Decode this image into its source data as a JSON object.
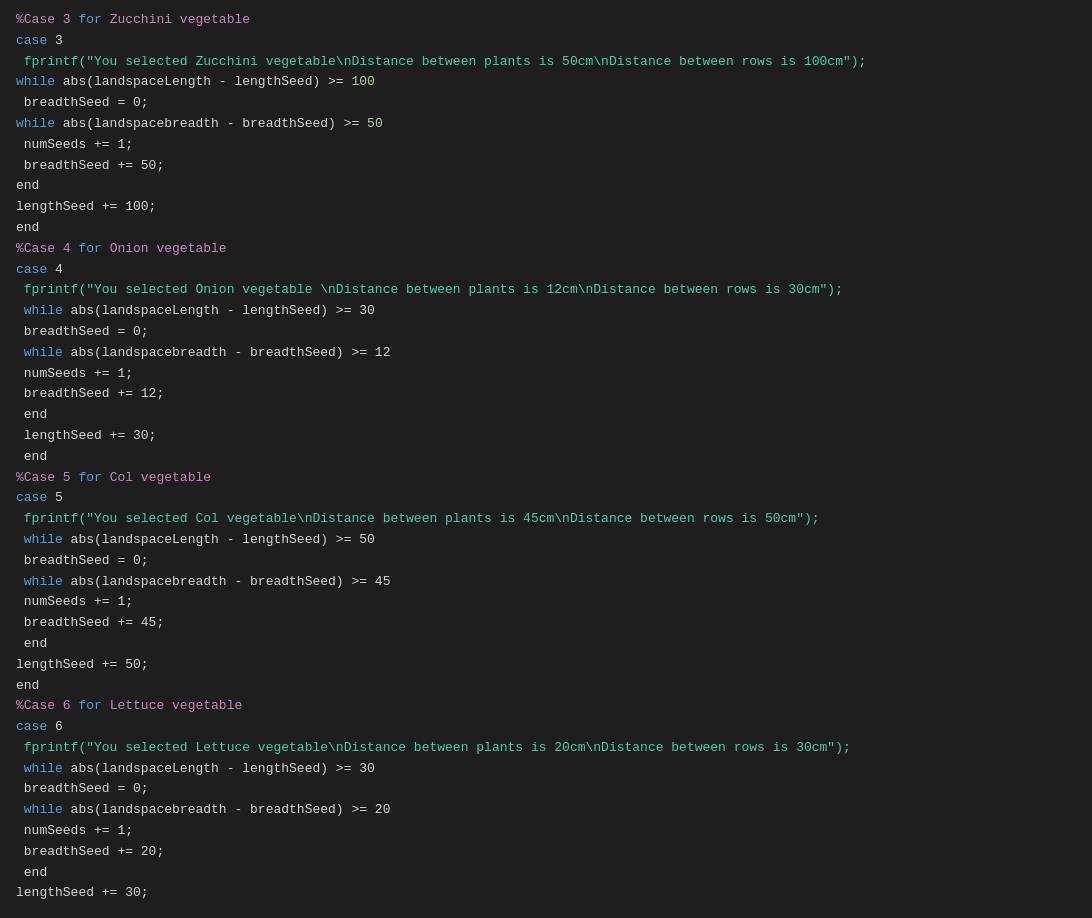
{
  "code": {
    "lines": [
      {
        "id": "l1",
        "parts": [
          {
            "text": "%Case 3 ",
            "cls": "comment"
          },
          {
            "text": "for",
            "cls": "keyword"
          },
          {
            "text": " Zucchini vegetable",
            "cls": "comment"
          }
        ]
      },
      {
        "id": "l2",
        "parts": [
          {
            "text": "case",
            "cls": "keyword"
          },
          {
            "text": " 3",
            "cls": "plain"
          }
        ]
      },
      {
        "id": "l3",
        "parts": [
          {
            "text": " fprintf(\"You selected Zucchini vegetable\\nDistance between plants is 50cm\\nDistance between rows is 100cm\");",
            "cls": "string"
          }
        ]
      },
      {
        "id": "l4",
        "parts": [
          {
            "text": "while",
            "cls": "keyword"
          },
          {
            "text": " abs(landspaceLength - lengthSeed) ",
            "cls": "plain"
          },
          {
            "text": ">=",
            "cls": "plain"
          },
          {
            "text": " 100",
            "cls": "number"
          }
        ]
      },
      {
        "id": "l5",
        "parts": [
          {
            "text": " breadthSeed = 0;",
            "cls": "plain"
          }
        ]
      },
      {
        "id": "l6",
        "parts": [
          {
            "text": "while",
            "cls": "keyword"
          },
          {
            "text": " abs(landspacebreadth - breadthSeed) ",
            "cls": "plain"
          },
          {
            "text": ">=",
            "cls": "plain"
          },
          {
            "text": " 50",
            "cls": "number"
          }
        ]
      },
      {
        "id": "l7",
        "parts": [
          {
            "text": " numSeeds += 1;",
            "cls": "plain"
          }
        ]
      },
      {
        "id": "l8",
        "parts": [
          {
            "text": " breadthSeed += 50;",
            "cls": "plain"
          }
        ]
      },
      {
        "id": "l9",
        "parts": [
          {
            "text": "end",
            "cls": "plain"
          }
        ]
      },
      {
        "id": "l10",
        "parts": [
          {
            "text": "lengthSeed += 100;",
            "cls": "plain"
          }
        ]
      },
      {
        "id": "l11",
        "parts": [
          {
            "text": "end",
            "cls": "plain"
          }
        ]
      },
      {
        "id": "l12",
        "parts": [
          {
            "text": "%Case 4 ",
            "cls": "comment"
          },
          {
            "text": "for",
            "cls": "keyword"
          },
          {
            "text": " Onion vegetable",
            "cls": "comment"
          }
        ]
      },
      {
        "id": "l13",
        "parts": [
          {
            "text": "case",
            "cls": "keyword"
          },
          {
            "text": " 4",
            "cls": "plain"
          }
        ]
      },
      {
        "id": "l14",
        "parts": [
          {
            "text": " fprintf(\"You selected Onion vegetable \\nDistance between plants is 12cm\\nDistance between rows is 30cm\");",
            "cls": "string"
          }
        ]
      },
      {
        "id": "l15",
        "parts": [
          {
            "text": " while",
            "cls": "keyword"
          },
          {
            "text": " abs(landspaceLength - lengthSeed) >= 30",
            "cls": "plain"
          }
        ]
      },
      {
        "id": "l16",
        "parts": [
          {
            "text": " breadthSeed = 0;",
            "cls": "plain"
          }
        ]
      },
      {
        "id": "l17",
        "parts": [
          {
            "text": " while",
            "cls": "keyword"
          },
          {
            "text": " abs(landspacebreadth - breadthSeed) >= 12",
            "cls": "plain"
          }
        ]
      },
      {
        "id": "l18",
        "parts": [
          {
            "text": " numSeeds += 1;",
            "cls": "plain"
          }
        ]
      },
      {
        "id": "l19",
        "parts": [
          {
            "text": " breadthSeed += 12;",
            "cls": "plain"
          }
        ]
      },
      {
        "id": "l20",
        "parts": [
          {
            "text": " end",
            "cls": "plain"
          }
        ]
      },
      {
        "id": "l21",
        "parts": [
          {
            "text": " lengthSeed += 30;",
            "cls": "plain"
          }
        ]
      },
      {
        "id": "l22",
        "parts": [
          {
            "text": " end",
            "cls": "plain"
          }
        ]
      },
      {
        "id": "l23",
        "parts": [
          {
            "text": "%Case 5 ",
            "cls": "comment"
          },
          {
            "text": "for",
            "cls": "keyword"
          },
          {
            "text": " Col vegetable",
            "cls": "comment"
          }
        ]
      },
      {
        "id": "l24",
        "parts": [
          {
            "text": "case",
            "cls": "keyword"
          },
          {
            "text": " 5",
            "cls": "plain"
          }
        ]
      },
      {
        "id": "l25",
        "parts": [
          {
            "text": " fprintf(\"You selected Col vegetable\\nDistance between plants is 45cm\\nDistance between rows is 50cm\");",
            "cls": "string"
          }
        ]
      },
      {
        "id": "l26",
        "parts": [
          {
            "text": " while",
            "cls": "keyword"
          },
          {
            "text": " abs(landspaceLength - lengthSeed) >= 50",
            "cls": "plain"
          }
        ]
      },
      {
        "id": "l27",
        "parts": [
          {
            "text": " breadthSeed = 0;",
            "cls": "plain"
          }
        ]
      },
      {
        "id": "l28",
        "parts": [
          {
            "text": " while",
            "cls": "keyword"
          },
          {
            "text": " abs(landspacebreadth - breadthSeed) >= 45",
            "cls": "plain"
          }
        ]
      },
      {
        "id": "l29",
        "parts": [
          {
            "text": " numSeeds += 1;",
            "cls": "plain"
          }
        ]
      },
      {
        "id": "l30",
        "parts": [
          {
            "text": " breadthSeed += 45;",
            "cls": "plain"
          }
        ]
      },
      {
        "id": "l31",
        "parts": [
          {
            "text": " end",
            "cls": "plain"
          }
        ]
      },
      {
        "id": "l32",
        "parts": [
          {
            "text": "lengthSeed += 50;",
            "cls": "plain"
          }
        ]
      },
      {
        "id": "l33",
        "parts": [
          {
            "text": "end",
            "cls": "plain"
          }
        ]
      },
      {
        "id": "l34",
        "parts": [
          {
            "text": "%Case 6 ",
            "cls": "comment"
          },
          {
            "text": "for",
            "cls": "keyword"
          },
          {
            "text": " Lettuce vegetable",
            "cls": "comment"
          }
        ]
      },
      {
        "id": "l35",
        "parts": [
          {
            "text": "case",
            "cls": "keyword"
          },
          {
            "text": " 6",
            "cls": "plain"
          }
        ]
      },
      {
        "id": "l36",
        "parts": [
          {
            "text": " fprintf(\"You selected Lettuce vegetable\\nDistance between plants is 20cm\\nDistance between rows is 30cm\");",
            "cls": "string"
          }
        ]
      },
      {
        "id": "l37",
        "parts": [
          {
            "text": " while",
            "cls": "keyword"
          },
          {
            "text": " abs(landspaceLength - lengthSeed) >= 30",
            "cls": "plain"
          }
        ]
      },
      {
        "id": "l38",
        "parts": [
          {
            "text": " breadthSeed = 0;",
            "cls": "plain"
          }
        ]
      },
      {
        "id": "l39",
        "parts": [
          {
            "text": " while",
            "cls": "keyword"
          },
          {
            "text": " abs(landspacebreadth - breadthSeed) >= 20",
            "cls": "plain"
          }
        ]
      },
      {
        "id": "l40",
        "parts": [
          {
            "text": " numSeeds += 1;",
            "cls": "plain"
          }
        ]
      },
      {
        "id": "l41",
        "parts": [
          {
            "text": " breadthSeed += 20;",
            "cls": "plain"
          }
        ]
      },
      {
        "id": "l42",
        "parts": [
          {
            "text": " end",
            "cls": "plain"
          }
        ]
      },
      {
        "id": "l43",
        "parts": [
          {
            "text": "lengthSeed += 30;",
            "cls": "plain"
          }
        ]
      }
    ]
  }
}
